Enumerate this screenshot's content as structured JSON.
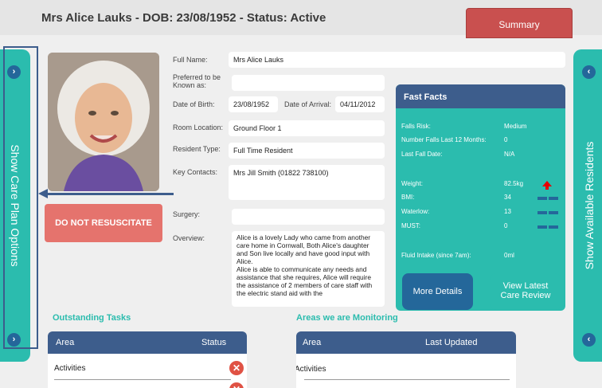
{
  "header": {
    "title": "Mrs Alice Lauks - DOB: 23/08/1952 - Status: Active",
    "summary_label": "Summary"
  },
  "side": {
    "left_label": "Show Care Plan Options",
    "right_label": "Show Available Residents",
    "left_chevron": "›",
    "right_chevron": "‹"
  },
  "dnr_label": "DO NOT RESUSCITATE",
  "form": {
    "full_name_label": "Full Name:",
    "full_name": "Mrs Alice Lauks",
    "preferred_label": "Preferred to be Known as:",
    "preferred": "",
    "dob_label": "Date of Birth:",
    "dob": "23/08/1952",
    "doa_label": "Date of Arrival:",
    "doa": "04/11/2012",
    "room_label": "Room Location:",
    "room": "Ground Floor 1",
    "type_label": "Resident Type:",
    "type": "Full Time Resident",
    "contacts_label": "Key Contacts:",
    "contacts": "Mrs Jill Smith (01822 738100)",
    "surgery_label": "Surgery:",
    "surgery": "",
    "overview_label": "Overview:",
    "overview": "Alice is a lovely Lady who came from another care home in Cornwall, Both Alice's daughter and Son live locally and have good input with Alice.\nAlice is able to communicate any needs and assistance that she requires, Alice will require the assistance of 2 members of care staff with the electric stand aid with the"
  },
  "fast_facts": {
    "title": "Fast Facts",
    "falls_risk_label": "Falls Risk:",
    "falls_risk": "Medium",
    "falls_12_label": "Number Falls Last 12 Months:",
    "falls_12": "0",
    "last_fall_label": "Last Fall Date:",
    "last_fall": "N/A",
    "weight_label": "Weight:",
    "weight": "82.5kg",
    "bmi_label": "BMI:",
    "bmi": "34",
    "waterlow_label": "Waterlow:",
    "waterlow": "13",
    "must_label": "MUST:",
    "must": "0",
    "fluid_label": "Fluid Intake (since 7am):",
    "fluid": "0ml"
  },
  "buttons": {
    "more_details": "More Details",
    "view_review_1": "View Latest",
    "view_review_2": "Care Review"
  },
  "outstanding": {
    "title": "Outstanding Tasks",
    "col_area": "Area",
    "col_status": "Status",
    "rows": [
      {
        "area": "Activities",
        "status_icon": "✕"
      }
    ]
  },
  "monitoring": {
    "title": "Areas we are Monitoring",
    "col_area": "Area",
    "col_updated": "Last Updated",
    "rows": [
      {
        "area": "Activities"
      }
    ]
  },
  "colors": {
    "teal": "#2bbcae",
    "navy": "#3d5d8c",
    "red": "#c9504f",
    "dnr": "#e5736d",
    "blue": "#24679a"
  }
}
